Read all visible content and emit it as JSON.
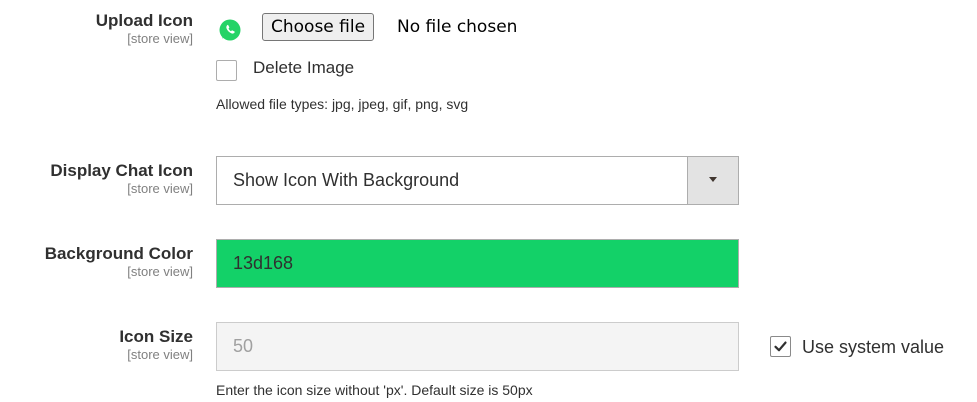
{
  "upload": {
    "label": "Upload Icon",
    "scope": "[store view]",
    "choose_button": "Choose file",
    "file_status": "No file chosen",
    "delete_label": "Delete Image",
    "allowed_note": "Allowed file types: jpg, jpeg, gif, png, svg",
    "icon": "whatsapp-icon"
  },
  "display_chat_icon": {
    "label": "Display Chat Icon",
    "scope": "[store view]",
    "selected": "Show Icon With Background"
  },
  "background_color": {
    "label": "Background Color",
    "scope": "[store view]",
    "value": "13d168",
    "swatch": "#13d168"
  },
  "icon_size": {
    "label": "Icon Size",
    "scope": "[store view]",
    "value": "50",
    "use_system_label": "Use system value",
    "use_system_checked": true,
    "note": "Enter the icon size without 'px'. Default size is 50px"
  }
}
